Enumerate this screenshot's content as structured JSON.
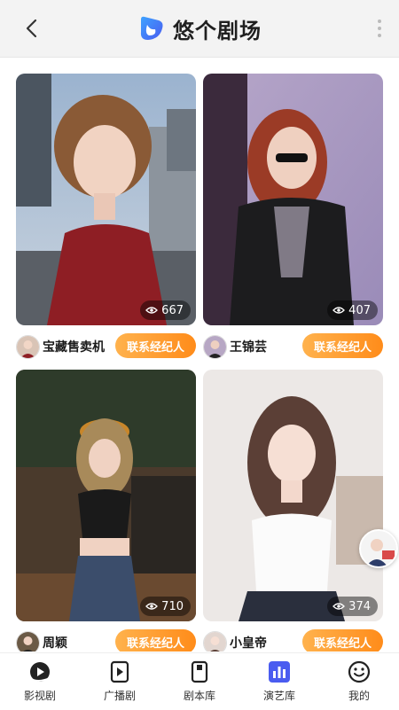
{
  "app": {
    "title": "悠个剧场"
  },
  "cards": [
    {
      "name": "宝藏售卖机",
      "views": "667",
      "contact_label": "联系经纪人"
    },
    {
      "name": "王锦芸",
      "views": "407",
      "contact_label": "联系经纪人"
    },
    {
      "name": "周颖",
      "views": "710",
      "contact_label": "联系经纪人"
    },
    {
      "name": "小皇帝",
      "views": "374",
      "contact_label": "联系经纪人"
    }
  ],
  "tabs": [
    {
      "label": "影视剧",
      "icon": "film-icon"
    },
    {
      "label": "广播剧",
      "icon": "play-icon"
    },
    {
      "label": "剧本库",
      "icon": "script-icon"
    },
    {
      "label": "演艺库",
      "icon": "chart-icon",
      "active": true
    },
    {
      "label": "我的",
      "icon": "smile-icon"
    }
  ],
  "colors": {
    "accent": "#4a5cf0",
    "button": "#ff9a2e"
  }
}
